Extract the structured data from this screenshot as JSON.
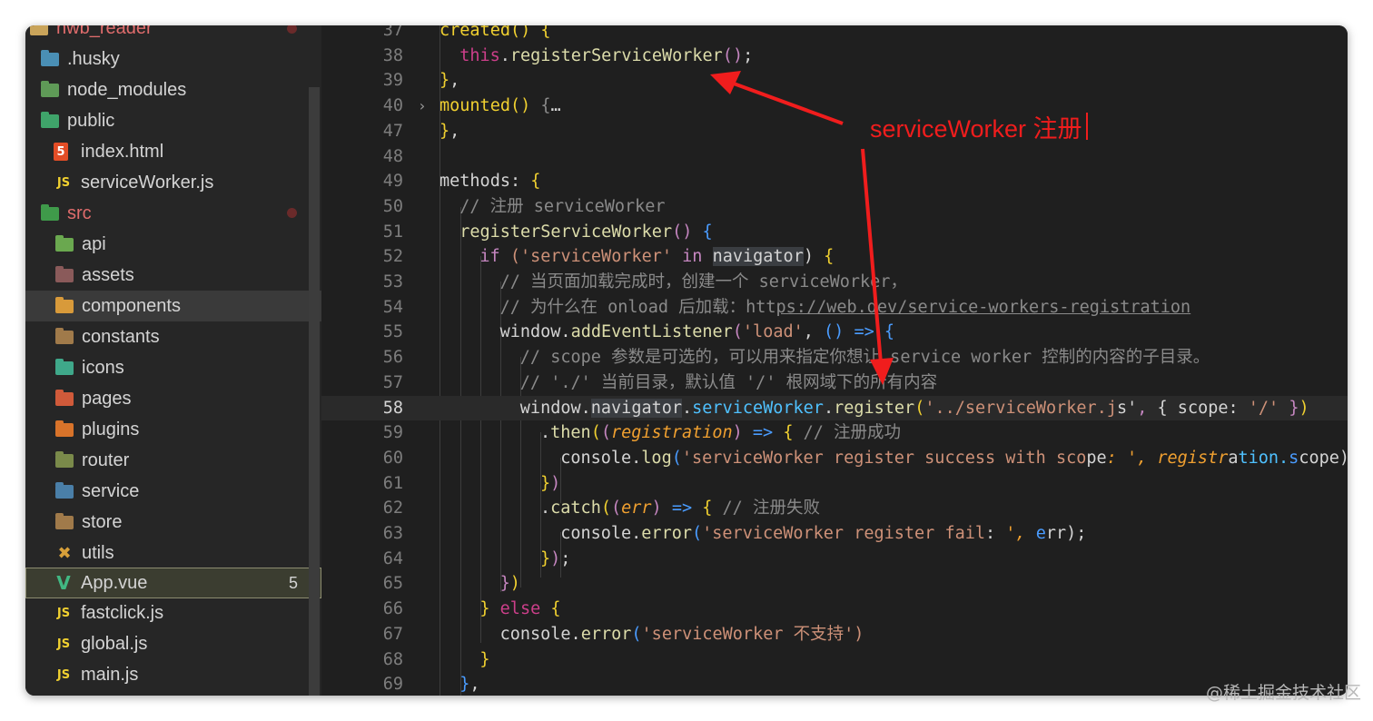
{
  "explorer": {
    "root_label": "nwb_reader",
    "items": [
      {
        "label": ".husky",
        "icon": "husky-folder-icon"
      },
      {
        "label": "node_modules",
        "icon": "node-folder-icon"
      },
      {
        "label": "public",
        "icon": "public-folder-icon"
      },
      {
        "label": "index.html",
        "icon": "html5-icon",
        "icon_text": "5"
      },
      {
        "label": "serviceWorker.js",
        "icon": "js-icon",
        "icon_text": "JS"
      },
      {
        "label": "src",
        "icon": "src-folder-icon"
      },
      {
        "label": "api",
        "icon": "api-folder-icon"
      },
      {
        "label": "assets",
        "icon": "assets-folder-icon"
      },
      {
        "label": "components",
        "icon": "components-folder-icon"
      },
      {
        "label": "constants",
        "icon": "folder-icon"
      },
      {
        "label": "icons",
        "icon": "images-folder-icon"
      },
      {
        "label": "pages",
        "icon": "pages-folder-icon"
      },
      {
        "label": "plugins",
        "icon": "plugins-folder-icon"
      },
      {
        "label": "router",
        "icon": "router-folder-icon"
      },
      {
        "label": "service",
        "icon": "service-folder-icon"
      },
      {
        "label": "store",
        "icon": "folder-icon"
      },
      {
        "label": "utils",
        "icon": "utils-folder-icon"
      },
      {
        "label": "App.vue",
        "icon": "vue-icon",
        "badge": "5"
      },
      {
        "label": "fastclick.js",
        "icon": "js-icon",
        "icon_text": "JS"
      },
      {
        "label": "global.js",
        "icon": "js-icon",
        "icon_text": "JS"
      },
      {
        "label": "main.js",
        "icon": "js-icon",
        "icon_text": "JS"
      }
    ]
  },
  "editor": {
    "current_line": "58",
    "lines": [
      {
        "n": "37",
        "t": "created() {"
      },
      {
        "n": "38",
        "t": "this.registerServiceWorker();"
      },
      {
        "n": "39",
        "t": "},"
      },
      {
        "n": "40",
        "t": "mounted() {…"
      },
      {
        "n": "47",
        "t": "},"
      },
      {
        "n": "48",
        "t": ""
      },
      {
        "n": "49",
        "t": "methods: {"
      },
      {
        "n": "50",
        "t": "// 注册 serviceWorker"
      },
      {
        "n": "51",
        "t": "registerServiceWorker() {"
      },
      {
        "n": "52",
        "t": "if ('serviceWorker' in navigator) {"
      },
      {
        "n": "53",
        "t": "// 当页面加载完成时，创建一个 serviceWorker，"
      },
      {
        "n": "54",
        "t": "// 为什么在 onload 后加载：https://web.dev/service-workers-registration"
      },
      {
        "n": "55",
        "t": "window.addEventListener('load', () => {"
      },
      {
        "n": "56",
        "t": "// scope 参数是可选的，可以用来指定你想让 service worker 控制的内容的子目录。"
      },
      {
        "n": "57",
        "t": "// './' 当前目录，默认值 '/' 根网域下的所有内容"
      },
      {
        "n": "58",
        "t": "window.navigator.serviceWorker.register('../serviceWorker.js', { scope: '/' })"
      },
      {
        "n": "59",
        "t": ".then((registration) => { // 注册成功"
      },
      {
        "n": "60",
        "t": "console.log('serviceWorker register success with scope: ', registration.scope)"
      },
      {
        "n": "61",
        "t": "})"
      },
      {
        "n": "62",
        "t": ".catch((err) => { // 注册失败"
      },
      {
        "n": "63",
        "t": "console.error('serviceWorker register fail: ', err);"
      },
      {
        "n": "64",
        "t": "});"
      },
      {
        "n": "65",
        "t": "})"
      },
      {
        "n": "66",
        "t": "} else {"
      },
      {
        "n": "67",
        "t": "console.error('serviceWorker 不支持')"
      },
      {
        "n": "68",
        "t": "}"
      },
      {
        "n": "69",
        "t": "},"
      }
    ]
  },
  "annotation": {
    "text": "serviceWorker 注册",
    "color": "#f01d1d"
  },
  "watermark": "@稀土掘金技术社区"
}
